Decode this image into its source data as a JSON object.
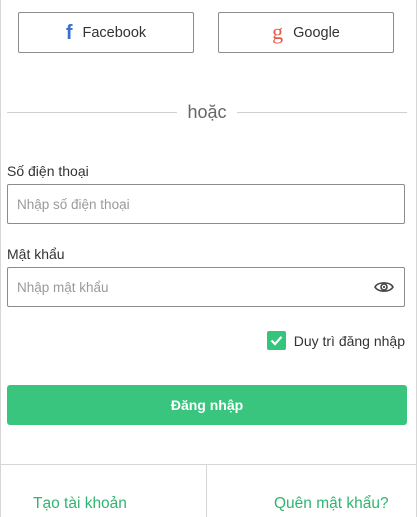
{
  "social": {
    "facebook": {
      "label": "Facebook",
      "icon": "facebook-icon",
      "color": "#3b6fd1"
    },
    "google": {
      "label": "Google",
      "icon": "google-icon",
      "color": "#e65a44"
    }
  },
  "divider_text": "hoặc",
  "phone": {
    "label": "Số điện thoại",
    "placeholder": "Nhập số điện thoại",
    "value": ""
  },
  "password": {
    "label": "Mật khẩu",
    "placeholder": "Nhập mật khẩu",
    "value": "",
    "toggle_icon": "eye-icon"
  },
  "remember": {
    "label": "Duy trì đăng nhập",
    "checked": true
  },
  "login_button": "Đăng nhập",
  "footer": {
    "create_account": "Tạo tài khoản",
    "forgot_password": "Quên mật khẩu?"
  },
  "colors": {
    "accent": "#39c57e",
    "link": "#2fb56f"
  }
}
